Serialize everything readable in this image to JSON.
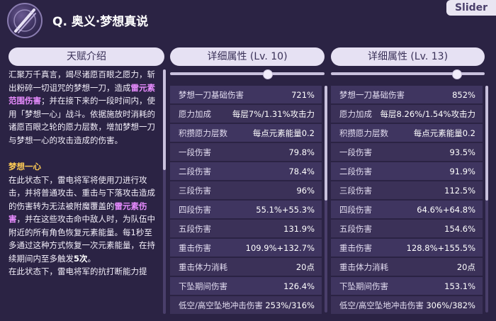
{
  "header": {
    "title": "Q. 奥义·梦想真说",
    "tag": "Slider"
  },
  "left": {
    "tab": "天赋介绍"
  },
  "columns": [
    {
      "tab": "详细属性 (Lv. 10)"
    },
    {
      "tab": "详细属性 (Lv. 13)"
    }
  ],
  "description": {
    "p1_part1": "汇聚万千真言，竭尽诸愿百眼之愿力，斩出粉碎一切诅咒的梦想一刀，造成",
    "p1_hl": "雷元素范围伤害",
    "p1_part2": "；并在接下来的一段时间内，使用「梦想一心」战斗。依据施放时消耗的诸愿百眼之轮的愿力层数，增加梦想一刀与梦想一心的攻击造成的伤害。",
    "sub_title": "梦想一心",
    "p2_part1": "在此状态下，雷电将军将使用刀进行攻击，并将普通攻击、重击与下落攻击造成的伤害转为无法被附魔覆盖的",
    "p2_hl": "雷元素伤害",
    "p2_part2": "，并在这些攻击命中敌人时，为队伍中附近的所有角色恢复元素能量。每1秒至多通过这种方式恢复一次元素能量，在持续期间内至多触发",
    "p2_em": "5次",
    "p2_part3": "。",
    "p3": "在此状态下，雷电将军的抗打断能力提"
  },
  "stats_lv10": [
    {
      "k": "梦想一刀基础伤害",
      "v": "721%"
    },
    {
      "k": "愿力加成",
      "v": "每层7%/1.31%攻击力"
    },
    {
      "k": "积攒愿力层数",
      "v": "每点元素能量0.2"
    },
    {
      "k": "一段伤害",
      "v": "79.8%"
    },
    {
      "k": "二段伤害",
      "v": "78.4%"
    },
    {
      "k": "三段伤害",
      "v": "96%"
    },
    {
      "k": "四段伤害",
      "v": "55.1%+55.3%"
    },
    {
      "k": "五段伤害",
      "v": "131.9%"
    },
    {
      "k": "重击伤害",
      "v": "109.9%+132.7%"
    },
    {
      "k": "重击体力消耗",
      "v": "20点"
    },
    {
      "k": "下坠期间伤害",
      "v": "126.4%"
    },
    {
      "k": "低空/高空坠地冲击伤害",
      "v": "253%/316%"
    }
  ],
  "stats_lv13": [
    {
      "k": "梦想一刀基础伤害",
      "v": "852%"
    },
    {
      "k": "愿力加成",
      "v": "每层8.26%/1.54%攻击力"
    },
    {
      "k": "积攒愿力层数",
      "v": "每点元素能量0.2"
    },
    {
      "k": "一段伤害",
      "v": "93.5%"
    },
    {
      "k": "二段伤害",
      "v": "91.9%"
    },
    {
      "k": "三段伤害",
      "v": "112.5%"
    },
    {
      "k": "四段伤害",
      "v": "64.6%+64.8%"
    },
    {
      "k": "五段伤害",
      "v": "154.6%"
    },
    {
      "k": "重击伤害",
      "v": "128.8%+155.5%"
    },
    {
      "k": "重击体力消耗",
      "v": "20点"
    },
    {
      "k": "下坠期间伤害",
      "v": "153.1%"
    },
    {
      "k": "低空/高空坠地冲击伤害",
      "v": "306%/382%"
    }
  ]
}
